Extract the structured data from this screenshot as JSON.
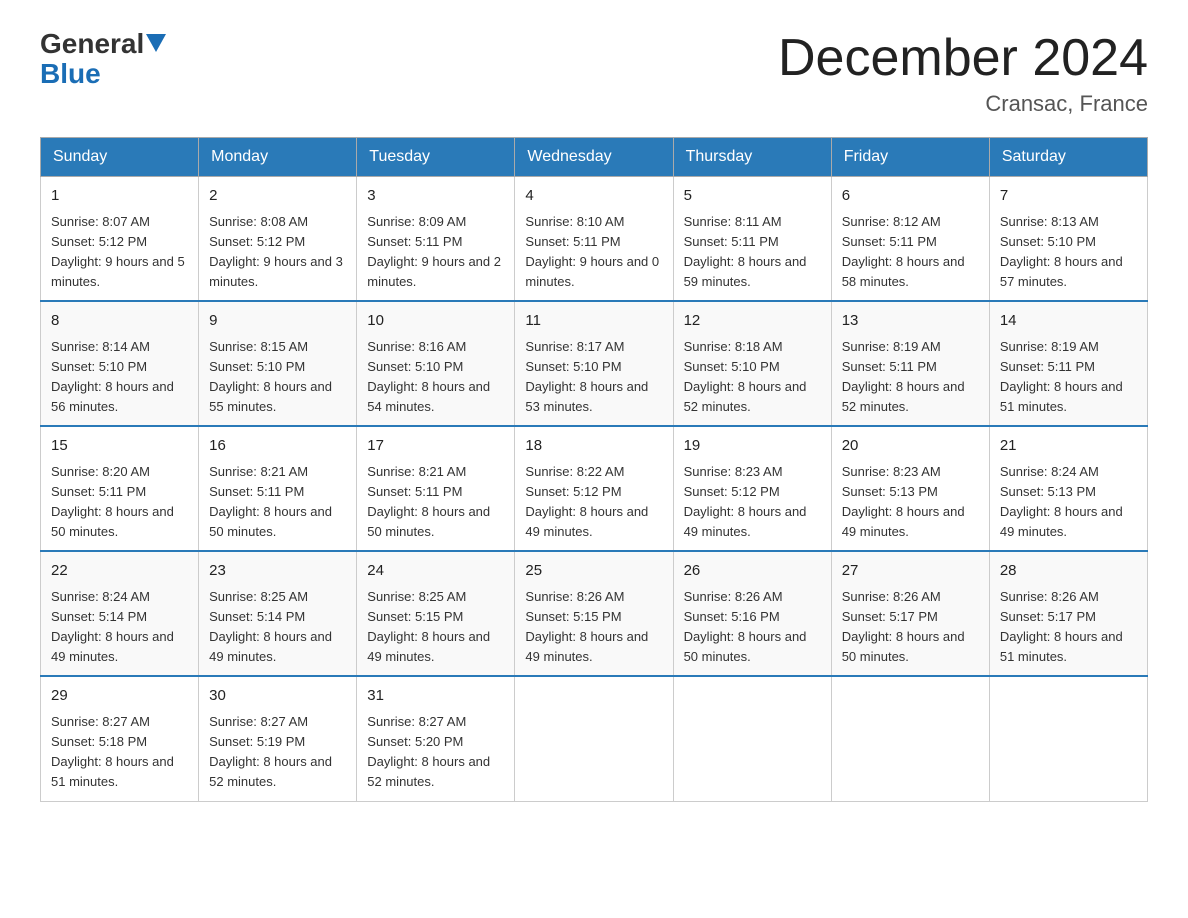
{
  "header": {
    "logo_general": "General",
    "logo_blue": "Blue",
    "main_title": "December 2024",
    "subtitle": "Cransac, France"
  },
  "calendar": {
    "days_of_week": [
      "Sunday",
      "Monday",
      "Tuesday",
      "Wednesday",
      "Thursday",
      "Friday",
      "Saturday"
    ],
    "weeks": [
      [
        {
          "day": "1",
          "sunrise": "8:07 AM",
          "sunset": "5:12 PM",
          "daylight": "9 hours and 5 minutes."
        },
        {
          "day": "2",
          "sunrise": "8:08 AM",
          "sunset": "5:12 PM",
          "daylight": "9 hours and 3 minutes."
        },
        {
          "day": "3",
          "sunrise": "8:09 AM",
          "sunset": "5:11 PM",
          "daylight": "9 hours and 2 minutes."
        },
        {
          "day": "4",
          "sunrise": "8:10 AM",
          "sunset": "5:11 PM",
          "daylight": "9 hours and 0 minutes."
        },
        {
          "day": "5",
          "sunrise": "8:11 AM",
          "sunset": "5:11 PM",
          "daylight": "8 hours and 59 minutes."
        },
        {
          "day": "6",
          "sunrise": "8:12 AM",
          "sunset": "5:11 PM",
          "daylight": "8 hours and 58 minutes."
        },
        {
          "day": "7",
          "sunrise": "8:13 AM",
          "sunset": "5:10 PM",
          "daylight": "8 hours and 57 minutes."
        }
      ],
      [
        {
          "day": "8",
          "sunrise": "8:14 AM",
          "sunset": "5:10 PM",
          "daylight": "8 hours and 56 minutes."
        },
        {
          "day": "9",
          "sunrise": "8:15 AM",
          "sunset": "5:10 PM",
          "daylight": "8 hours and 55 minutes."
        },
        {
          "day": "10",
          "sunrise": "8:16 AM",
          "sunset": "5:10 PM",
          "daylight": "8 hours and 54 minutes."
        },
        {
          "day": "11",
          "sunrise": "8:17 AM",
          "sunset": "5:10 PM",
          "daylight": "8 hours and 53 minutes."
        },
        {
          "day": "12",
          "sunrise": "8:18 AM",
          "sunset": "5:10 PM",
          "daylight": "8 hours and 52 minutes."
        },
        {
          "day": "13",
          "sunrise": "8:19 AM",
          "sunset": "5:11 PM",
          "daylight": "8 hours and 52 minutes."
        },
        {
          "day": "14",
          "sunrise": "8:19 AM",
          "sunset": "5:11 PM",
          "daylight": "8 hours and 51 minutes."
        }
      ],
      [
        {
          "day": "15",
          "sunrise": "8:20 AM",
          "sunset": "5:11 PM",
          "daylight": "8 hours and 50 minutes."
        },
        {
          "day": "16",
          "sunrise": "8:21 AM",
          "sunset": "5:11 PM",
          "daylight": "8 hours and 50 minutes."
        },
        {
          "day": "17",
          "sunrise": "8:21 AM",
          "sunset": "5:11 PM",
          "daylight": "8 hours and 50 minutes."
        },
        {
          "day": "18",
          "sunrise": "8:22 AM",
          "sunset": "5:12 PM",
          "daylight": "8 hours and 49 minutes."
        },
        {
          "day": "19",
          "sunrise": "8:23 AM",
          "sunset": "5:12 PM",
          "daylight": "8 hours and 49 minutes."
        },
        {
          "day": "20",
          "sunrise": "8:23 AM",
          "sunset": "5:13 PM",
          "daylight": "8 hours and 49 minutes."
        },
        {
          "day": "21",
          "sunrise": "8:24 AM",
          "sunset": "5:13 PM",
          "daylight": "8 hours and 49 minutes."
        }
      ],
      [
        {
          "day": "22",
          "sunrise": "8:24 AM",
          "sunset": "5:14 PM",
          "daylight": "8 hours and 49 minutes."
        },
        {
          "day": "23",
          "sunrise": "8:25 AM",
          "sunset": "5:14 PM",
          "daylight": "8 hours and 49 minutes."
        },
        {
          "day": "24",
          "sunrise": "8:25 AM",
          "sunset": "5:15 PM",
          "daylight": "8 hours and 49 minutes."
        },
        {
          "day": "25",
          "sunrise": "8:26 AM",
          "sunset": "5:15 PM",
          "daylight": "8 hours and 49 minutes."
        },
        {
          "day": "26",
          "sunrise": "8:26 AM",
          "sunset": "5:16 PM",
          "daylight": "8 hours and 50 minutes."
        },
        {
          "day": "27",
          "sunrise": "8:26 AM",
          "sunset": "5:17 PM",
          "daylight": "8 hours and 50 minutes."
        },
        {
          "day": "28",
          "sunrise": "8:26 AM",
          "sunset": "5:17 PM",
          "daylight": "8 hours and 51 minutes."
        }
      ],
      [
        {
          "day": "29",
          "sunrise": "8:27 AM",
          "sunset": "5:18 PM",
          "daylight": "8 hours and 51 minutes."
        },
        {
          "day": "30",
          "sunrise": "8:27 AM",
          "sunset": "5:19 PM",
          "daylight": "8 hours and 52 minutes."
        },
        {
          "day": "31",
          "sunrise": "8:27 AM",
          "sunset": "5:20 PM",
          "daylight": "8 hours and 52 minutes."
        },
        null,
        null,
        null,
        null
      ]
    ]
  }
}
